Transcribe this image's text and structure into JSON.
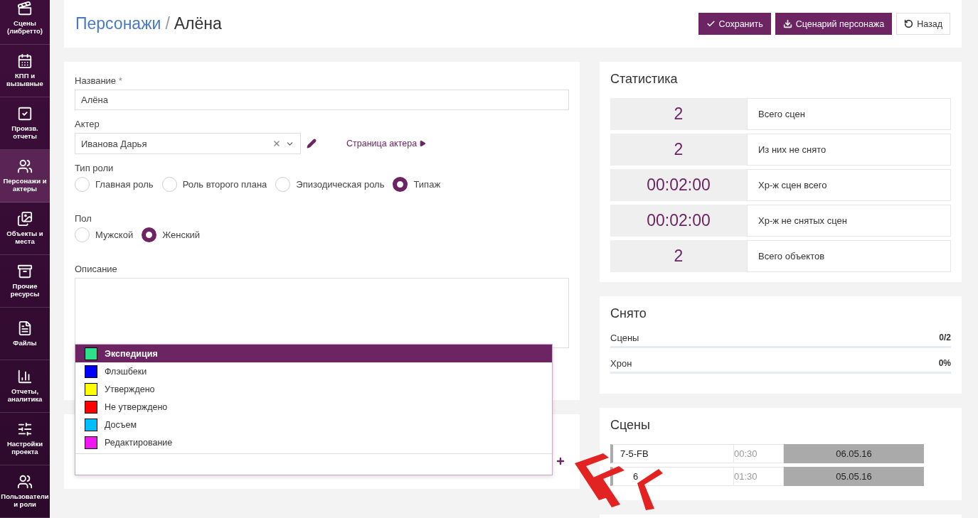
{
  "sidebar": {
    "items": [
      {
        "label": "Сцены (либретто)",
        "selected": false
      },
      {
        "label": "КПП и вызывные",
        "selected": false
      },
      {
        "label": "Произв. отчеты",
        "selected": false
      },
      {
        "label": "Персонажи и актеры",
        "selected": true
      },
      {
        "label": "Объекты и места",
        "selected": false
      },
      {
        "label": "Прочие ресурсы",
        "selected": false
      },
      {
        "label": "Файлы",
        "selected": false
      },
      {
        "label": "Отчеты, аналитика",
        "selected": false
      },
      {
        "label": "Настройки проекта",
        "selected": false
      },
      {
        "label": "Пользователи и роли",
        "selected": false
      }
    ]
  },
  "header": {
    "breadcrumb": "Персонажи",
    "separator": "/",
    "title": "Алёна",
    "buttons": [
      {
        "label": "Сохранить",
        "kind": "primary"
      },
      {
        "label": "Сценарий персонажа",
        "kind": "primary"
      },
      {
        "label": "Назад",
        "kind": "default"
      }
    ]
  },
  "form": {
    "name": {
      "label": "Название",
      "required": "*",
      "value": "Алёна"
    },
    "actor": {
      "label": "Актер",
      "value": "Иванова Дарья",
      "link": "Страница актера"
    },
    "role_type": {
      "label": "Тип роли",
      "options": [
        {
          "label": "Главная роль",
          "selected": false
        },
        {
          "label": "Роль второго плана",
          "selected": false
        },
        {
          "label": "Эпизодическая роль",
          "selected": false
        },
        {
          "label": "Типаж",
          "selected": true
        }
      ]
    },
    "gender": {
      "label": "Пол",
      "options": [
        {
          "label": "Мужской",
          "selected": false
        },
        {
          "label": "Женский",
          "selected": true
        }
      ]
    },
    "description": {
      "label": "Описание"
    }
  },
  "tag_dropdown": {
    "options": [
      {
        "label": "Экспедиция",
        "color": "#2ee08a",
        "selected": true
      },
      {
        "label": "Флэшбеки",
        "color": "#0000ff",
        "selected": false
      },
      {
        "label": "Утверждено",
        "color": "#ffff00",
        "selected": false
      },
      {
        "label": "Не утверждено",
        "color": "#ff0000",
        "selected": false
      },
      {
        "label": "Досъем",
        "color": "#00bfff",
        "selected": false
      },
      {
        "label": "Редактирование",
        "color": "#f018f0",
        "selected": false
      }
    ]
  },
  "statistics": {
    "title": "Статистика",
    "rows": [
      {
        "value": "2",
        "label": "Всего сцен"
      },
      {
        "value": "2",
        "label": "Из них не снято"
      },
      {
        "value": "00:02:00",
        "label": "Хр-ж сцен всего"
      },
      {
        "value": "00:02:00",
        "label": "Хр-ж не снятых сцен"
      },
      {
        "value": "2",
        "label": "Всего объектов"
      }
    ]
  },
  "shot": {
    "title": "Снято",
    "bars": [
      {
        "label": "Сцены",
        "reading": "0/2",
        "level": 0
      },
      {
        "label": "Хрон",
        "reading": "0%",
        "level": 0
      }
    ]
  },
  "scenes": {
    "title": "Сцены",
    "rows": [
      {
        "name": "7-5-FB",
        "duration": "00:30",
        "date": "06.05.16"
      },
      {
        "name": "6",
        "duration": "01:30",
        "date": "05.05.16"
      }
    ]
  }
}
